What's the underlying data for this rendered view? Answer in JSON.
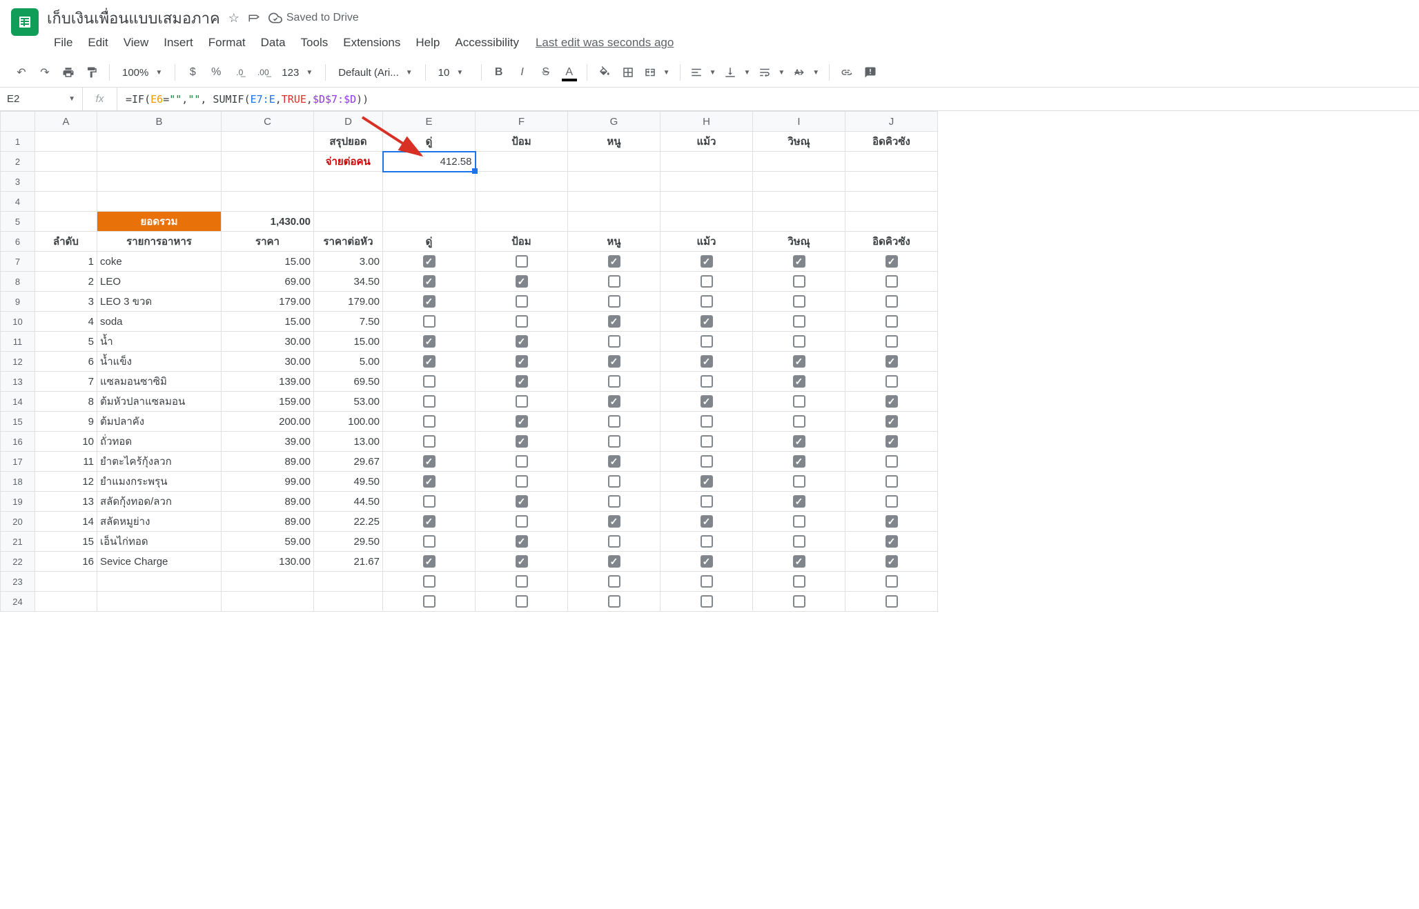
{
  "doc": {
    "title": "เก็บเงินเพื่อนแบบเสมอภาค",
    "saved": "Saved to Drive",
    "last_edit": "Last edit was seconds ago"
  },
  "menu": {
    "file": "File",
    "edit": "Edit",
    "view": "View",
    "insert": "Insert",
    "format": "Format",
    "data": "Data",
    "tools": "Tools",
    "extensions": "Extensions",
    "help": "Help",
    "accessibility": "Accessibility"
  },
  "toolbar": {
    "zoom": "100%",
    "currency": "$",
    "percent": "%",
    "dec_dec": ".0",
    "inc_dec": ".00",
    "numfmt": "123",
    "font": "Default (Ari...",
    "fontsize": "10"
  },
  "formula_bar": {
    "name_box": "E2",
    "fx": "fx"
  },
  "columns": [
    "A",
    "B",
    "C",
    "D",
    "E",
    "F",
    "G",
    "H",
    "I",
    "J"
  ],
  "chart_data": {
    "type": "table",
    "header_row1": {
      "D": "สรุปยอด",
      "E": "ดู่",
      "F": "ป้อม",
      "G": "หนู",
      "H": "แม้ว",
      "I": "วิษณุ",
      "J": "อิดคิวซัง"
    },
    "header_row2": {
      "D": "จ่ายต่อคน",
      "E": "412.58"
    },
    "total_row": {
      "B": "ยอดรวม",
      "C": "1,430.00"
    },
    "header_row6": {
      "A": "ลำดับ",
      "B": "รายการอาหาร",
      "C": "ราคา",
      "D": "ราคาต่อหัว",
      "E": "ดู่",
      "F": "ป้อม",
      "G": "หนู",
      "H": "แม้ว",
      "I": "วิษณุ",
      "J": "อิดคิวซัง"
    },
    "rows": [
      {
        "n": "1",
        "item": "coke",
        "price": "15.00",
        "per": "3.00",
        "chk": [
          true,
          false,
          true,
          true,
          true,
          true
        ]
      },
      {
        "n": "2",
        "item": "LEO",
        "price": "69.00",
        "per": "34.50",
        "chk": [
          true,
          true,
          false,
          false,
          false,
          false
        ]
      },
      {
        "n": "3",
        "item": "LEO 3 ขวด",
        "price": "179.00",
        "per": "179.00",
        "chk": [
          true,
          false,
          false,
          false,
          false,
          false
        ]
      },
      {
        "n": "4",
        "item": "soda",
        "price": "15.00",
        "per": "7.50",
        "chk": [
          false,
          false,
          true,
          true,
          false,
          false
        ]
      },
      {
        "n": "5",
        "item": "น้ำ",
        "price": "30.00",
        "per": "15.00",
        "chk": [
          true,
          true,
          false,
          false,
          false,
          false
        ]
      },
      {
        "n": "6",
        "item": "น้ำแข็ง",
        "price": "30.00",
        "per": "5.00",
        "chk": [
          true,
          true,
          true,
          true,
          true,
          true
        ]
      },
      {
        "n": "7",
        "item": "แซลมอนซาซิมิ",
        "price": "139.00",
        "per": "69.50",
        "chk": [
          false,
          true,
          false,
          false,
          true,
          false
        ]
      },
      {
        "n": "8",
        "item": "ต้มหัวปลาแซลมอน",
        "price": "159.00",
        "per": "53.00",
        "chk": [
          false,
          false,
          true,
          true,
          false,
          true
        ]
      },
      {
        "n": "9",
        "item": "ต้มปลาคัง",
        "price": "200.00",
        "per": "100.00",
        "chk": [
          false,
          true,
          false,
          false,
          false,
          true
        ]
      },
      {
        "n": "10",
        "item": "ถั่วทอด",
        "price": "39.00",
        "per": "13.00",
        "chk": [
          false,
          true,
          false,
          false,
          true,
          true
        ]
      },
      {
        "n": "11",
        "item": "ยำตะไคร้กุ้งลวก",
        "price": "89.00",
        "per": "29.67",
        "chk": [
          true,
          false,
          true,
          false,
          true,
          false
        ]
      },
      {
        "n": "12",
        "item": "ยำแมงกระพรุน",
        "price": "99.00",
        "per": "49.50",
        "chk": [
          true,
          false,
          false,
          true,
          false,
          false
        ]
      },
      {
        "n": "13",
        "item": "สลัดกุ้งทอด/ลวก",
        "price": "89.00",
        "per": "44.50",
        "chk": [
          false,
          true,
          false,
          false,
          true,
          false
        ]
      },
      {
        "n": "14",
        "item": "สลัดหมูย่าง",
        "price": "89.00",
        "per": "22.25",
        "chk": [
          true,
          false,
          true,
          true,
          false,
          true
        ]
      },
      {
        "n": "15",
        "item": "เอ็นไก่ทอด",
        "price": "59.00",
        "per": "29.50",
        "chk": [
          false,
          true,
          false,
          false,
          false,
          true
        ]
      },
      {
        "n": "16",
        "item": "Sevice Charge",
        "price": "130.00",
        "per": "21.67",
        "chk": [
          true,
          true,
          true,
          true,
          true,
          true
        ]
      }
    ],
    "empty_rows": [
      {
        "chk": [
          false,
          false,
          false,
          false,
          false,
          false
        ]
      },
      {
        "chk": [
          false,
          false,
          false,
          false,
          false,
          false
        ]
      }
    ]
  }
}
